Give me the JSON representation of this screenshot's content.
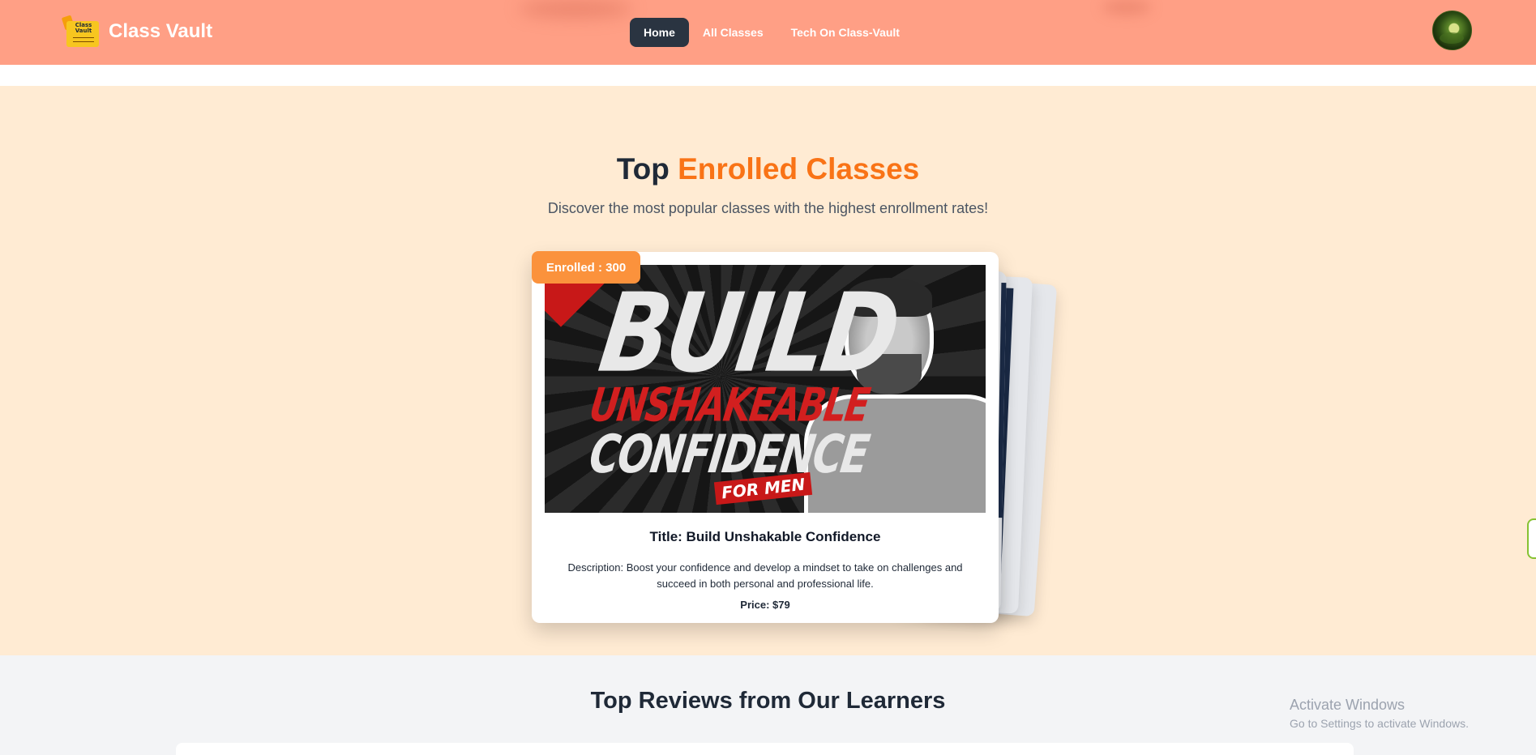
{
  "nav": {
    "brand": "Class Vault",
    "logo_text": "Class Vault",
    "links": [
      "Home",
      "All Classes",
      "Tech On Class-Vault"
    ],
    "active": "Home"
  },
  "enrolled": {
    "title_plain": "Top",
    "title_accent": "Enrolled Classes",
    "subtitle": "Discover the most popular classes with the highest enrollment rates!",
    "card": {
      "badge": "Enrolled : 300",
      "thumb_text": [
        "BUILD",
        "UNSHAKEABLE",
        "CONFIDENCE",
        "FOR MEN"
      ],
      "title": "Title: Build Unshakable Confidence",
      "description": "Description: Boost your confidence and develop a mindset to take on challenges and succeed in both personal and professional life.",
      "price": "Price: $79"
    }
  },
  "reviews": {
    "title": "Top Reviews from Our Learners"
  },
  "watermark": {
    "line1": "Activate Windows",
    "line2": "Go to Settings to activate Windows."
  },
  "colors": {
    "navbar": "#ff9f85",
    "active_link": "#2a3441",
    "accent": "#f97316",
    "section_bg": "#ffebd3",
    "badge": "#fb923c"
  }
}
